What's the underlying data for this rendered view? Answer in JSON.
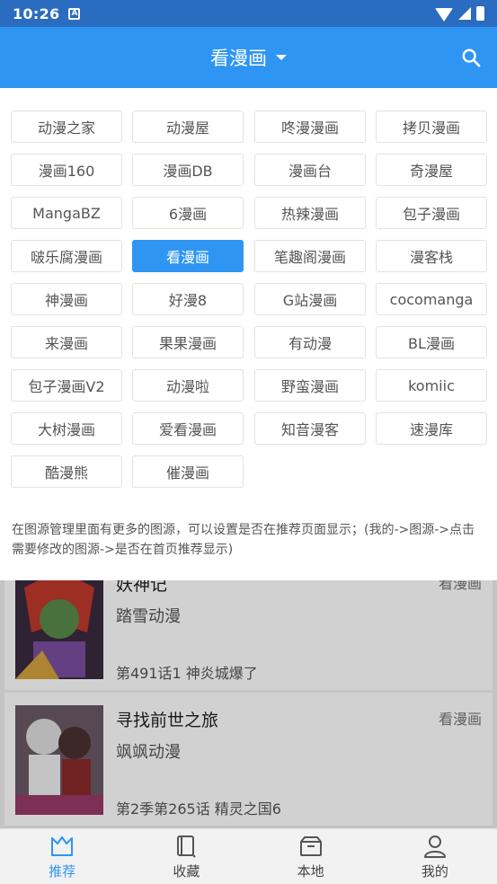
{
  "status_bar": {
    "time": "10:26",
    "notif_letter": "A"
  },
  "app_bar": {
    "title": "看漫画"
  },
  "sources": [
    "动漫之家",
    "动漫屋",
    "咚漫漫画",
    "拷贝漫画",
    "漫画160",
    "漫画DB",
    "漫画台",
    "奇漫屋",
    "MangaBZ",
    "6漫画",
    "热辣漫画",
    "包子漫画",
    "啵乐腐漫画",
    "看漫画",
    "笔趣阁漫画",
    "漫客栈",
    "神漫画",
    "好漫8",
    "G站漫画",
    "cocomanga",
    "来漫画",
    "果果漫画",
    "有动漫",
    "BL漫画",
    "包子漫画V2",
    "动漫啦",
    "野蛮漫画",
    "komiic",
    "大树漫画",
    "爱看漫画",
    "知音漫客",
    "速漫库",
    "酷漫熊",
    "催漫画"
  ],
  "selected_source": "看漫画",
  "note": "在图源管理里面有更多的图源，可以设置是否在推荐页面显示；(我的->图源->点击需要修改的图源->是否在首页推荐显示)",
  "comics": [
    {
      "title": "妖神记",
      "source": "看漫画",
      "author": "踏雪动漫",
      "chapter": "第491话1 神炎城爆了"
    },
    {
      "title": "寻找前世之旅",
      "source": "看漫画",
      "author": "飒飒动漫",
      "chapter": "第2季第265话 精灵之国6"
    }
  ],
  "bottom_nav": [
    {
      "label": "推荐",
      "icon": "crown-icon",
      "active": true
    },
    {
      "label": "收藏",
      "icon": "book-icon",
      "active": false
    },
    {
      "label": "本地",
      "icon": "box-icon",
      "active": false
    },
    {
      "label": "我的",
      "icon": "person-icon",
      "active": false
    }
  ],
  "colors": {
    "accent": "#2f95f3",
    "status_bar": "#2a6cbf"
  }
}
